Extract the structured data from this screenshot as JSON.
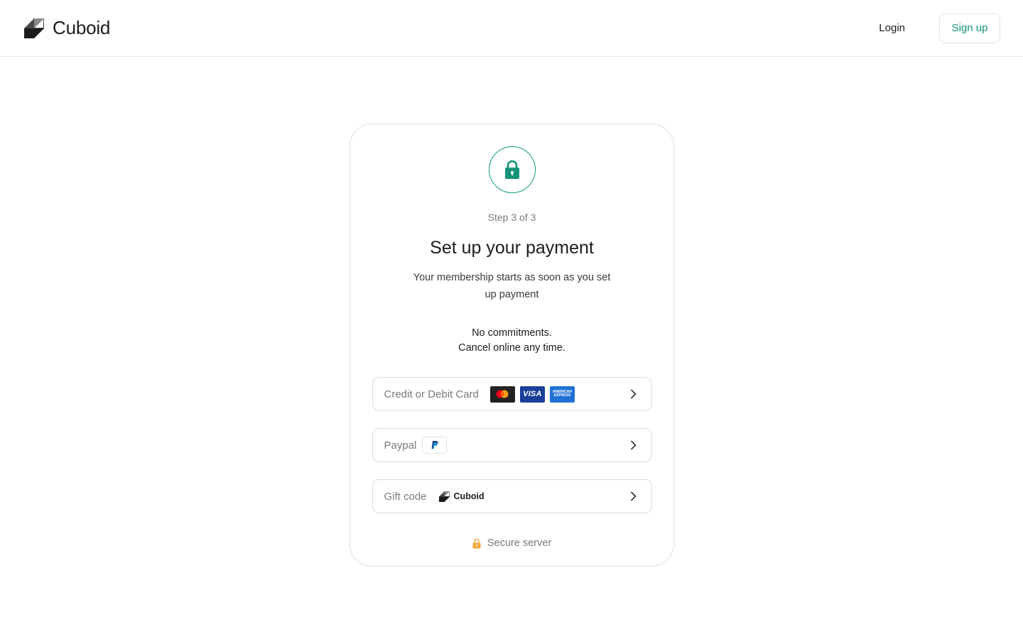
{
  "header": {
    "brand_name": "Cuboid",
    "login_label": "Login",
    "signup_label": "Sign up"
  },
  "payment": {
    "step_label": "Step 3 of 3",
    "title": "Set up your payment",
    "subtitle": "Your membership starts as soon as you set up payment",
    "commitment_line1": "No commitments.",
    "commitment_line2": "Cancel online any time.",
    "methods": [
      {
        "label": "Credit or Debit Card",
        "logos": [
          "mastercard-icon",
          "visa-icon",
          "american-express-icon"
        ]
      },
      {
        "label": "Paypal",
        "logos": [
          "paypal-icon"
        ]
      },
      {
        "label": "Gift code",
        "brand": "Cuboid"
      }
    ],
    "card_logo_text": {
      "visa": "VISA",
      "amex_line1": "AMERICAN",
      "amex_line2": "EXPRESS"
    },
    "secure_label": "Secure server"
  },
  "colors": {
    "accent": "#119478",
    "lock_orange": "#f2a93b",
    "border": "#dcdcdc",
    "muted_text": "#7a7a7a"
  }
}
